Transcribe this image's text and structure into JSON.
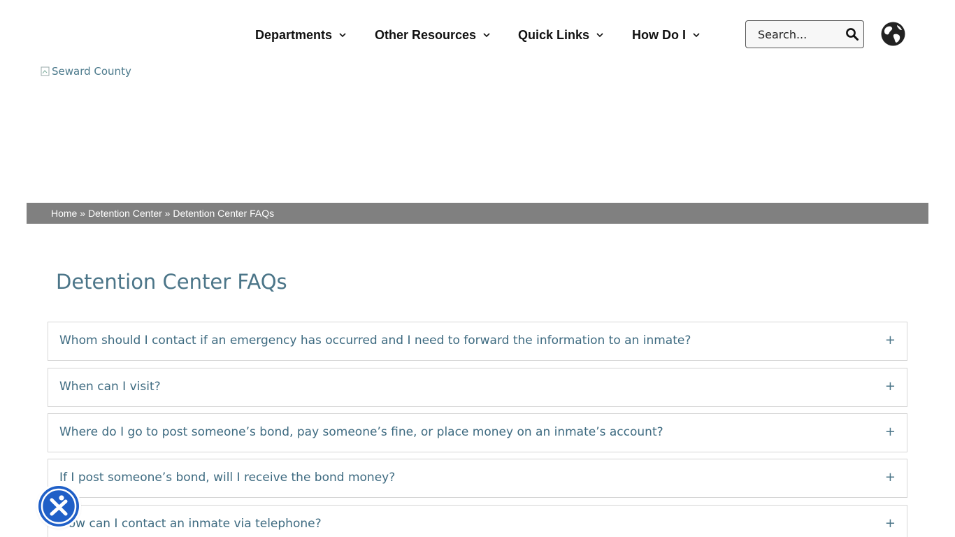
{
  "nav": {
    "items": [
      {
        "label": "Departments"
      },
      {
        "label": "Other Resources"
      },
      {
        "label": "Quick Links"
      },
      {
        "label": "How Do I"
      }
    ],
    "search_placeholder": "Search..."
  },
  "logo": {
    "alt": "Seward County"
  },
  "breadcrumb": {
    "home": "Home",
    "sep": "»",
    "parent": "Detention Center",
    "current": "Detention Center FAQs"
  },
  "page": {
    "title": "Detention Center FAQs"
  },
  "faqs": [
    {
      "question": "Whom should I contact if an emergency has occurred and I need to forward the information to an inmate?"
    },
    {
      "question": "When can I visit?"
    },
    {
      "question": "Where do I go to post someone’s bond, pay someone’s fine, or place money on an inmate’s account?"
    },
    {
      "question": "If I post someone’s bond, will I receive the bond money?"
    },
    {
      "question": "How can I contact an inmate via telephone?"
    }
  ],
  "icons": {
    "expand": "+",
    "search": "search-icon",
    "globe": "globe-icon",
    "dropdown": "chevron-down-icon",
    "accessibility": "accessibility-icon"
  },
  "colors": {
    "heading": "#4b7588",
    "question": "#3d6a80",
    "breadcrumb_bg": "#808080",
    "accessibility_bg": "#1f5fc7"
  }
}
